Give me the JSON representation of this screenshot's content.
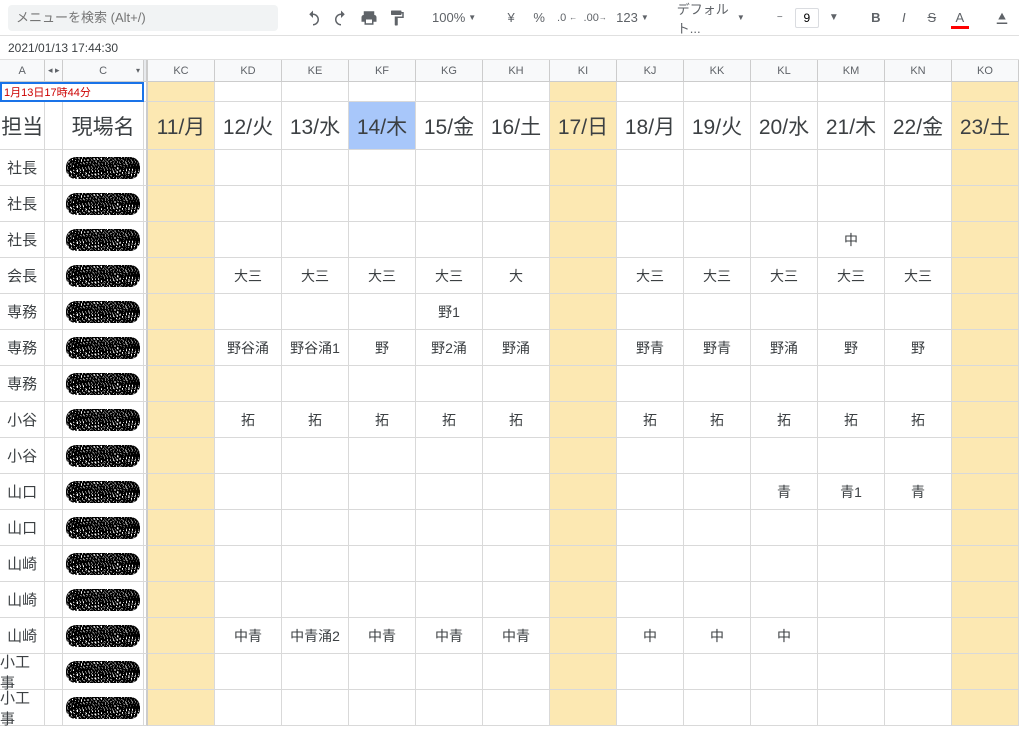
{
  "toolbar": {
    "search_placeholder": "メニューを検索 (Alt+/)",
    "zoom": "100%",
    "currency": "¥",
    "percent": "%",
    "dec_dec": ".0",
    "dec_inc": ".00",
    "more_formats": "123",
    "font": "デフォルト...",
    "font_size": "9",
    "bold": "B",
    "italic": "I",
    "strike": "S",
    "text_color": "A"
  },
  "name_box": "2021/01/13 17:44:30",
  "col_letters": {
    "a": "A",
    "c": "C",
    "arrows": "◂ ▸"
  },
  "columns": [
    "KC",
    "KD",
    "KE",
    "KF",
    "KG",
    "KH",
    "KI",
    "KJ",
    "KK",
    "KL",
    "KM",
    "KN",
    "KO"
  ],
  "top_note": "1月13日17時44分",
  "headers": {
    "tantou": "担当",
    "genba": "現場名",
    "dates": [
      "11/月",
      "12/火",
      "13/水",
      "14/木",
      "15/金",
      "16/土",
      "17/日",
      "18/月",
      "19/火",
      "20/水",
      "21/木",
      "22/金",
      "23/土"
    ]
  },
  "weekend_cols": [
    0,
    6,
    12
  ],
  "selected_col": 3,
  "rows": [
    {
      "tantou": "社長",
      "cells": [
        "",
        "",
        "",
        "",
        "",
        "",
        "",
        "",
        "",
        "",
        "",
        "",
        ""
      ]
    },
    {
      "tantou": "社長",
      "cells": [
        "",
        "",
        "",
        "",
        "",
        "",
        "",
        "",
        "",
        "",
        "",
        "",
        ""
      ]
    },
    {
      "tantou": "社長",
      "cells": [
        "",
        "",
        "",
        "",
        "",
        "",
        "",
        "",
        "",
        "",
        "中",
        "",
        ""
      ]
    },
    {
      "tantou": "会長",
      "cells": [
        "",
        "大三",
        "大三",
        "大三",
        "大三",
        "大",
        "",
        "大三",
        "大三",
        "大三",
        "大三",
        "大三",
        ""
      ]
    },
    {
      "tantou": "専務",
      "cells": [
        "",
        "",
        "",
        "",
        "野1",
        "",
        "",
        "",
        "",
        "",
        "",
        "",
        ""
      ]
    },
    {
      "tantou": "専務",
      "cells": [
        "",
        "野谷涌",
        "野谷涌1",
        "野",
        "野2涌",
        "野涌",
        "",
        "野青",
        "野青",
        "野涌",
        "野",
        "野",
        ""
      ]
    },
    {
      "tantou": "専務",
      "cells": [
        "",
        "",
        "",
        "",
        "",
        "",
        "",
        "",
        "",
        "",
        "",
        "",
        ""
      ]
    },
    {
      "tantou": "小谷",
      "cells": [
        "",
        "拓",
        "拓",
        "拓",
        "拓",
        "拓",
        "",
        "拓",
        "拓",
        "拓",
        "拓",
        "拓",
        ""
      ]
    },
    {
      "tantou": "小谷",
      "cells": [
        "",
        "",
        "",
        "",
        "",
        "",
        "",
        "",
        "",
        "",
        "",
        "",
        ""
      ]
    },
    {
      "tantou": "山口",
      "cells": [
        "",
        "",
        "",
        "",
        "",
        "",
        "",
        "",
        "",
        "青",
        "青1",
        "青",
        ""
      ]
    },
    {
      "tantou": "山口",
      "cells": [
        "",
        "",
        "",
        "",
        "",
        "",
        "",
        "",
        "",
        "",
        "",
        "",
        ""
      ]
    },
    {
      "tantou": "山崎",
      "cells": [
        "",
        "",
        "",
        "",
        "",
        "",
        "",
        "",
        "",
        "",
        "",
        "",
        ""
      ]
    },
    {
      "tantou": "山崎",
      "cells": [
        "",
        "",
        "",
        "",
        "",
        "",
        "",
        "",
        "",
        "",
        "",
        "",
        ""
      ]
    },
    {
      "tantou": "山崎",
      "cells": [
        "",
        "中青",
        "中青涌2",
        "中青",
        "中青",
        "中青",
        "",
        "中",
        "中",
        "中",
        "",
        "",
        ""
      ]
    },
    {
      "tantou": "小工事",
      "cells": [
        "",
        "",
        "",
        "",
        "",
        "",
        "",
        "",
        "",
        "",
        "",
        "",
        ""
      ]
    },
    {
      "tantou": "小工事",
      "cells": [
        "",
        "",
        "",
        "",
        "",
        "",
        "",
        "",
        "",
        "",
        "",
        "",
        ""
      ]
    }
  ]
}
